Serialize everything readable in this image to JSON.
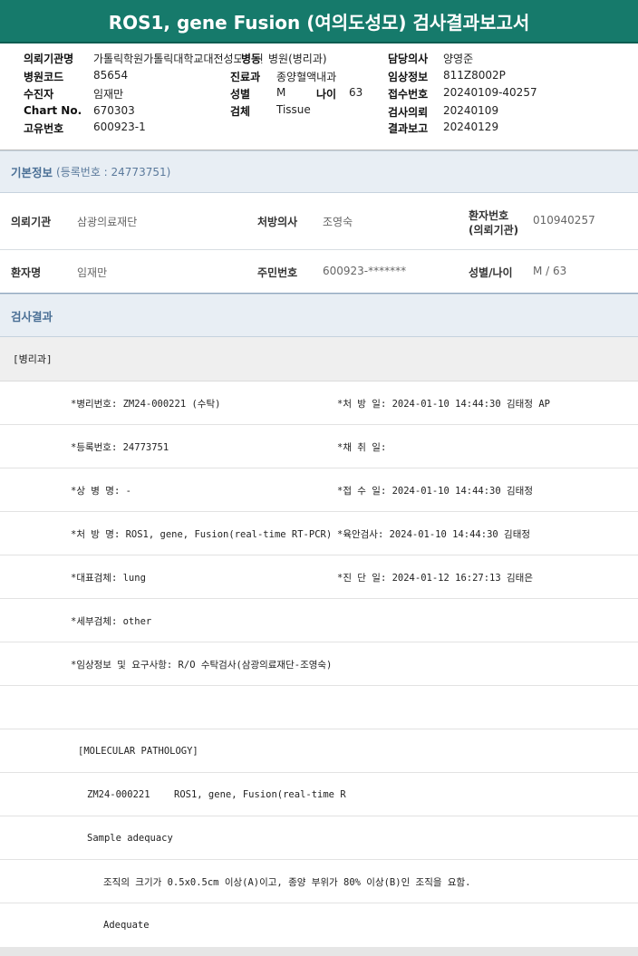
{
  "report": {
    "title": "ROS1, gene Fusion (여의도성모) 검사결과보고서"
  },
  "header": {
    "institution_label": "의뢰기관명",
    "institution_value": "가톨릭학원가톨릭대학교대전성모병원",
    "hospital_code_label": "병원코드",
    "hospital_code_value": "85654",
    "examinee_label": "수진자",
    "examinee_value": "임재만",
    "chart_no_label": "Chart No.",
    "chart_no_value": "670303",
    "unique_no_label": "고유번호",
    "unique_no_value": "600923-1",
    "ward_label": "병동",
    "ward_value": "병원(병리과)",
    "dept_label": "진료과",
    "dept_value": "종양혈액내과",
    "sex_label": "성별",
    "sex_value": "M",
    "age_label": "나이",
    "age_value": "63",
    "specimen_label": "검체",
    "specimen_value": "Tissue",
    "doctor_label": "담당의사",
    "doctor_value": "양영준",
    "clinical_label": "임상정보",
    "clinical_value": "811Z8002P",
    "receipt_label": "접수번호",
    "receipt_value": "20240109-40257",
    "request_label": "검사의뢰",
    "request_value": "20240109",
    "result_label": "결과보고",
    "result_value": "20240129"
  },
  "basic_info": {
    "heading": "기본정보",
    "registration": "(등록번호 : 24773751)",
    "org_label": "의뢰기관",
    "org_value": "삼광의료재단",
    "prescriber_label": "처방의사",
    "prescriber_value": "조영숙",
    "patient_no_label_line1": "환자번호",
    "patient_no_label_line2": "(의뢰기관)",
    "patient_no_value": "010940257",
    "patient_name_label": "환자명",
    "patient_name_value": "임재만",
    "resident_no_label": "주민번호",
    "resident_no_value": "600923-*******",
    "sex_age_label": "성별/나이",
    "sex_age_value": "M / 63"
  },
  "results": {
    "heading": "검사결과",
    "dept_tag": "[병리과]",
    "rows": [
      {
        "left": "*병리번호: ZM24-000221 (수탁)",
        "right": "*처 방 일: 2024-01-10 14:44:30  김태정 AP"
      },
      {
        "left": "*등록번호: 24773751",
        "right": "*채 취 일:"
      },
      {
        "left": "*상 병 명: -",
        "right": "*접 수 일: 2024-01-10 14:44:30  김태정"
      },
      {
        "left": "*처 방 명: ROS1, gene, Fusion(real-time RT-PCR)",
        "right": "*육안검사: 2024-01-10 14:44:30  김태정"
      },
      {
        "left": "*대표검체: lung",
        "right": "*진 단 일: 2024-01-12 16:27:13  김태은"
      },
      {
        "left": "*세부검체: other",
        "right": ""
      },
      {
        "left": "*임상정보 및 요구사항: R/O 수탁검사(삼광의료재단-조영숙)",
        "right": ""
      }
    ],
    "molecular_heading": "[MOLECULAR PATHOLOGY]",
    "case_id": "ZM24-000221",
    "case_test": "ROS1, gene, Fusion(real-time R",
    "adequacy_heading": "Sample adequacy",
    "adequacy_criteria": "조직의 크기가 0.5x0.5cm 이상(A)이고, 종양 부위가 80% 이상(B)인 조직을 요함.",
    "adequacy_result": "Adequate"
  }
}
